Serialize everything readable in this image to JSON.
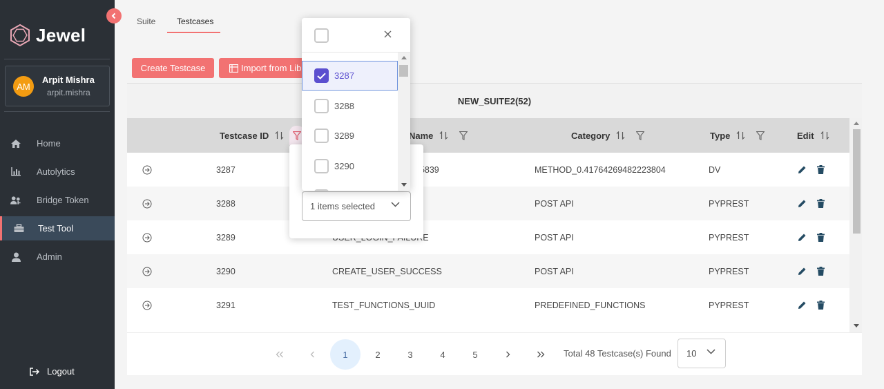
{
  "app": {
    "name": "Jewel"
  },
  "user": {
    "initials": "AM",
    "name": "Arpit Mishra",
    "handle": "arpit.mishra"
  },
  "nav": {
    "items": [
      {
        "label": "Home",
        "icon": "home-icon"
      },
      {
        "label": "Autolytics",
        "icon": "bar-chart-icon"
      },
      {
        "label": "Bridge Token",
        "icon": "users-key-icon"
      },
      {
        "label": "Test Tool",
        "icon": "toolbox-icon"
      },
      {
        "label": "Admin",
        "icon": "user-icon"
      }
    ],
    "active": "Test Tool",
    "logout_label": "Logout"
  },
  "tabs": [
    {
      "label": "Suite"
    },
    {
      "label": "Testcases"
    }
  ],
  "actions": {
    "create_label": "Create Testcase",
    "import_label": "Import from Lib"
  },
  "suite": {
    "title": "NEW_SUITE2(52)"
  },
  "table": {
    "headers": {
      "id": "Testcase ID",
      "name": "Name",
      "category": "Category",
      "type": "Type",
      "edit": "Edit"
    },
    "rows": [
      {
        "id": "3287",
        "name": "05839",
        "category": "METHOD_0.41764269482223804",
        "type": "DV"
      },
      {
        "id": "3288",
        "name": "",
        "category": "POST API",
        "type": "PYPREST"
      },
      {
        "id": "3289",
        "name": "USER_LOGIN_FAILURE",
        "category": "POST API",
        "type": "PYPREST"
      },
      {
        "id": "3290",
        "name": "CREATE_USER_SUCCESS",
        "category": "POST API",
        "type": "PYPREST"
      },
      {
        "id": "3291",
        "name": "TEST_FUNCTIONS_UUID",
        "category": "PREDEFINED_FUNCTIONS",
        "type": "PYPREST"
      }
    ]
  },
  "pagination": {
    "pages": [
      "1",
      "2",
      "3",
      "4",
      "5"
    ],
    "current": "1",
    "total_text": "Total 48 Testcase(s) Found",
    "rows_per_page": "10"
  },
  "filter": {
    "options": [
      {
        "value": "3287",
        "checked": true
      },
      {
        "value": "3288",
        "checked": false
      },
      {
        "value": "3289",
        "checked": false
      },
      {
        "value": "3290",
        "checked": false
      }
    ],
    "summary": "1 items selected"
  },
  "colors": {
    "accent": "#f27272",
    "sidebar": "#2b3036",
    "check": "#5b4fcf",
    "avatar": "#f39c12"
  }
}
